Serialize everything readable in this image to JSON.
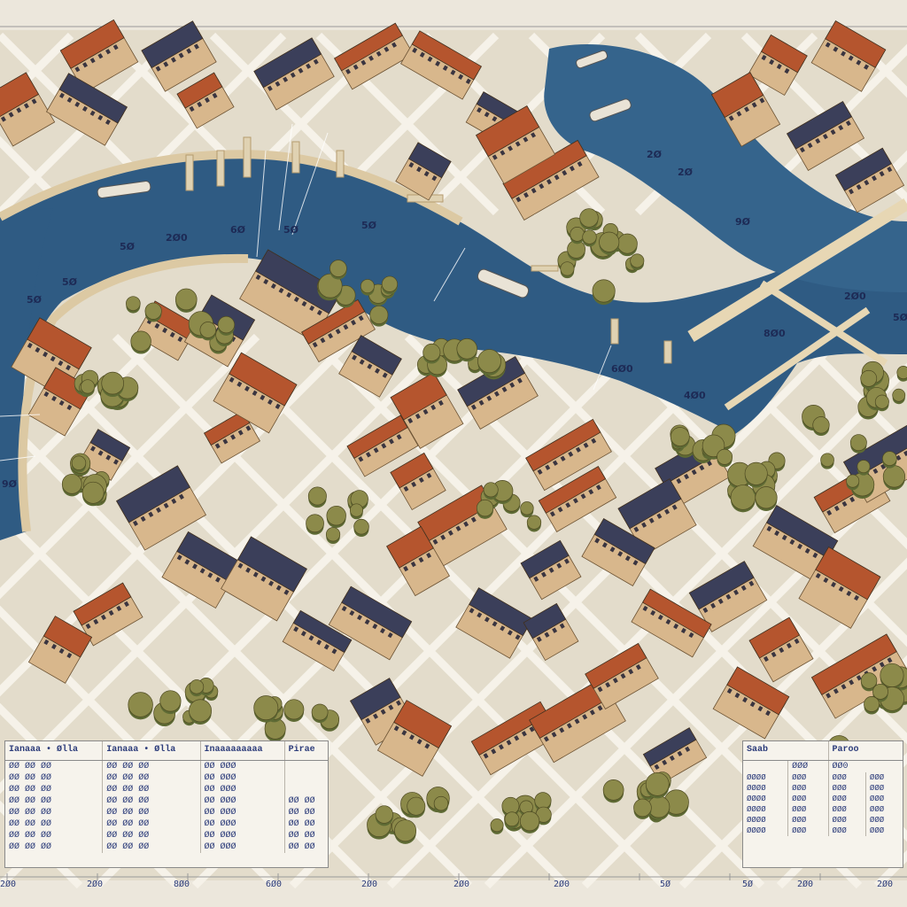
{
  "map": {
    "colors": {
      "paper": "#ece7dc",
      "water": "#2f5b83",
      "water_light": "#3f6f97",
      "quay": "#dcc9a3",
      "block": "#e6dfd0",
      "road": "#f4f0e6",
      "roof_red": "#b5552e",
      "roof_dark": "#3b3f5a",
      "facade": "#d8b78c",
      "tree": "#8c8a4a",
      "tree_dark": "#5e6a34",
      "ink": "#2c3c7a"
    },
    "water_labels": [
      "5Ø",
      "2Ø0",
      "6Ø",
      "5Ø",
      "5Ø",
      "5Ø",
      "5Ø",
      "2Ø",
      "2Ø",
      "9Ø",
      "2Ø0",
      "8Ø0",
      "5Ø",
      "6Ø0",
      "4Ø0",
      "9Ø"
    ],
    "bottom_scale": [
      "2Ø0",
      "2Ø0",
      "8Ø0",
      "6Ø0",
      "2Ø0",
      "2Ø0",
      "2Ø0",
      "5Ø",
      "5Ø",
      "2Ø0",
      "2Ø0"
    ]
  },
  "left_table": {
    "headers": [
      "Ianaaa • Ølla",
      "Ianaaa • Ølla",
      "Inaaaaaaaaa",
      "Pirae"
    ],
    "rows": [
      [
        "ØØ ØØ ØØ",
        "ØØ ØØ ØØ",
        "ØØ ØØØ",
        ""
      ],
      [
        "ØØ ØØ ØØ",
        "ØØ ØØ ØØ",
        "ØØ ØØØ",
        ""
      ],
      [
        "ØØ ØØ ØØ",
        "ØØ ØØ ØØ",
        "ØØ ØØØ",
        ""
      ],
      [
        "ØØ ØØ ØØ",
        "ØØ ØØ ØØ",
        "ØØ ØØØ",
        "ØØ  ØØ"
      ],
      [
        "ØØ ØØ ØØ",
        "ØØ ØØ ØØ",
        "ØØ ØØØ",
        "ØØ  ØØ"
      ],
      [
        "ØØ ØØ ØØ",
        "ØØ ØØ ØØ",
        "ØØ ØØØ",
        "ØØ  ØØ"
      ],
      [
        "ØØ ØØ ØØ",
        "ØØ ØØ ØØ",
        "ØØ ØØØ",
        "ØØ  ØØ"
      ],
      [
        "ØØ ØØ ØØ",
        "ØØ ØØ ØØ",
        "ØØ ØØØ",
        "ØØ  ØØ"
      ]
    ]
  },
  "right_table": {
    "headers": [
      "Saab",
      "Paroo"
    ],
    "subrow": [
      "",
      "ØØØ",
      "ØØ0"
    ],
    "rows": [
      [
        "ØØØØ",
        "ØØØ",
        "ØØØ",
        "ØØØ"
      ],
      [
        "ØØØØ",
        "ØØØ",
        "ØØØ",
        "ØØØ"
      ],
      [
        "ØØØØ",
        "ØØØ",
        "ØØØ",
        "ØØØ"
      ],
      [
        "ØØØØ",
        "ØØØ",
        "ØØØ",
        "ØØØ"
      ],
      [
        "ØØØØ",
        "ØØØ",
        "ØØØ",
        "ØØØ"
      ],
      [
        "ØØØØ",
        "ØØØ",
        "ØØØ",
        "ØØØ"
      ]
    ]
  }
}
